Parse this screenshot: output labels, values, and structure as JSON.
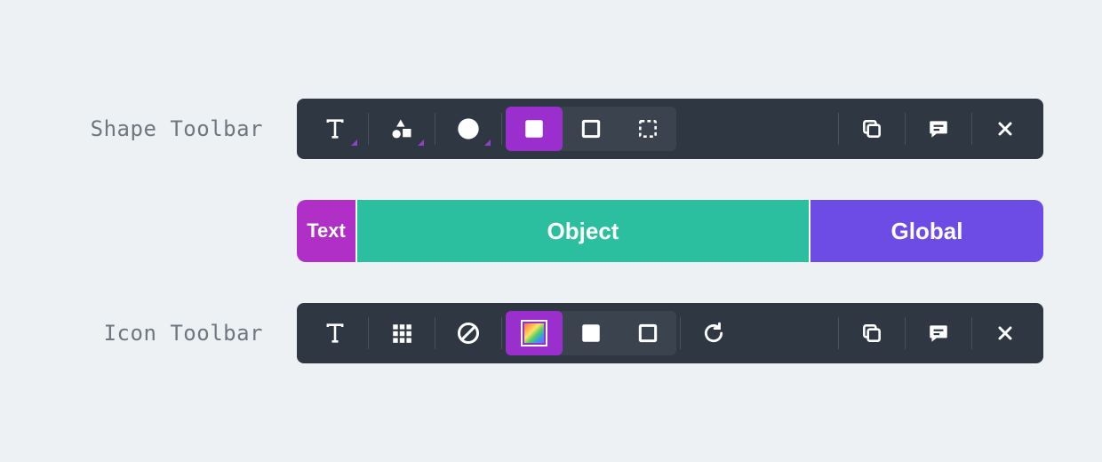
{
  "labels": {
    "shape_toolbar": "Shape Toolbar",
    "icon_toolbar": "Icon Toolbar"
  },
  "sections": {
    "text": "Text",
    "object": "Object",
    "global": "Global"
  },
  "colors": {
    "toolbar_bg": "#2f3742",
    "accent_purple": "#9b2fce",
    "section_text": "#b030c7",
    "section_object": "#2bbf9f",
    "section_global": "#6d4ce6"
  },
  "shape_toolbar": {
    "tools": [
      {
        "name": "text-tool",
        "has_submenu": true
      },
      {
        "name": "shapes-tool",
        "has_submenu": true
      },
      {
        "name": "fill-color",
        "has_submenu": true
      },
      {
        "name": "fill-solid",
        "active": true
      },
      {
        "name": "fill-outline"
      },
      {
        "name": "fill-dashed"
      },
      {
        "name": "copy-action"
      },
      {
        "name": "comment-action"
      },
      {
        "name": "close-action"
      }
    ]
  },
  "icon_toolbar": {
    "tools": [
      {
        "name": "text-tool"
      },
      {
        "name": "grid-tool"
      },
      {
        "name": "no-fill"
      },
      {
        "name": "color-swatch",
        "active": true
      },
      {
        "name": "fill-solid"
      },
      {
        "name": "fill-outline"
      },
      {
        "name": "rotate-action"
      },
      {
        "name": "copy-action"
      },
      {
        "name": "comment-action"
      },
      {
        "name": "close-action"
      }
    ]
  }
}
